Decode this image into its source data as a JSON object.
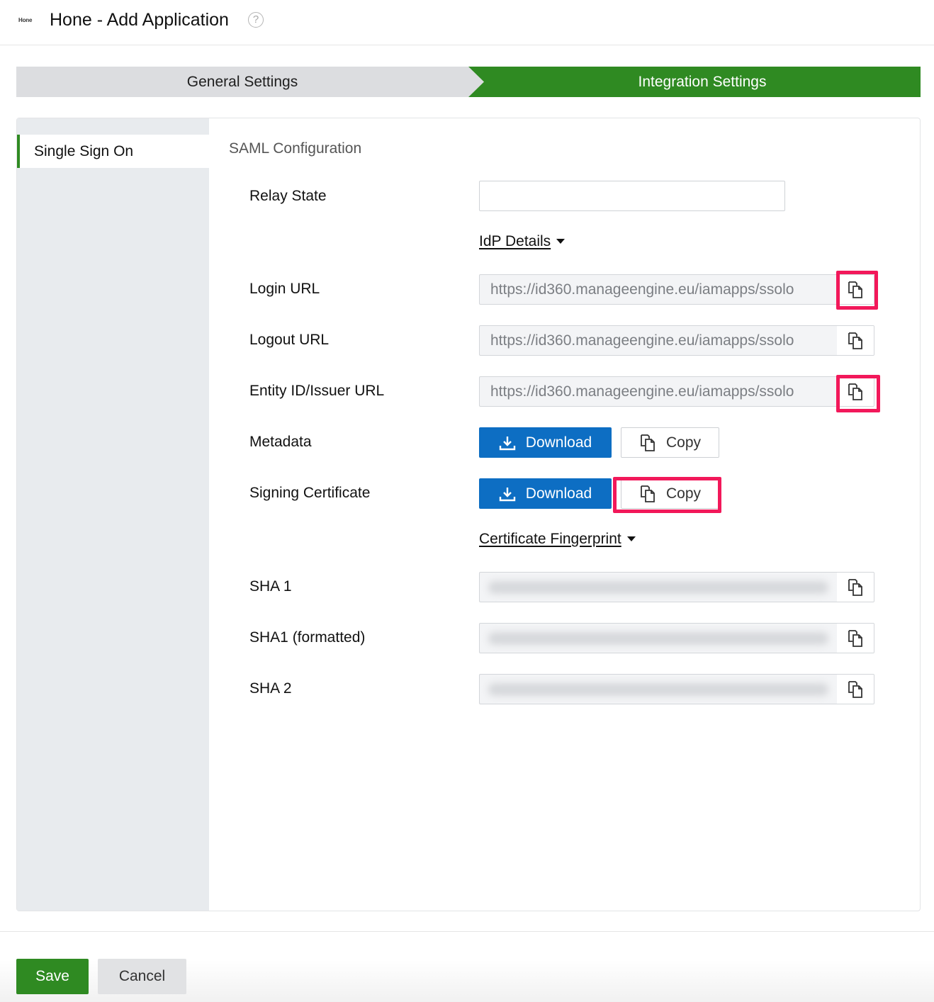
{
  "header": {
    "logo_text": "Hone",
    "title": "Hone - Add Application",
    "help_glyph": "?"
  },
  "steps": {
    "general": "General Settings",
    "integration": "Integration Settings"
  },
  "sidebar": {
    "items": [
      {
        "label": "Single Sign On"
      }
    ]
  },
  "saml": {
    "section_title": "SAML Configuration",
    "relay_state": {
      "label": "Relay State",
      "value": ""
    },
    "idp_details_label": "IdP Details",
    "login_url": {
      "label": "Login URL",
      "value": "https://id360.manageengine.eu/iamapps/ssolo"
    },
    "logout_url": {
      "label": "Logout URL",
      "value": "https://id360.manageengine.eu/iamapps/ssolo"
    },
    "entity_id": {
      "label": "Entity ID/Issuer URL",
      "value": "https://id360.manageengine.eu/iamapps/ssolo"
    },
    "metadata": {
      "label": "Metadata",
      "download_label": "Download",
      "copy_label": "Copy"
    },
    "signing_certificate": {
      "label": "Signing Certificate",
      "download_label": "Download",
      "copy_label": "Copy"
    },
    "certificate_fingerprint_label": "Certificate Fingerprint",
    "sha1": {
      "label": "SHA 1"
    },
    "sha1_formatted": {
      "label": "SHA1 (formatted)"
    },
    "sha2": {
      "label": "SHA 2"
    }
  },
  "footer": {
    "save_label": "Save",
    "cancel_label": "Cancel"
  },
  "colors": {
    "brand_green": "#2f8a22",
    "primary_blue": "#0d6ec3",
    "highlight": "#f2185a"
  }
}
